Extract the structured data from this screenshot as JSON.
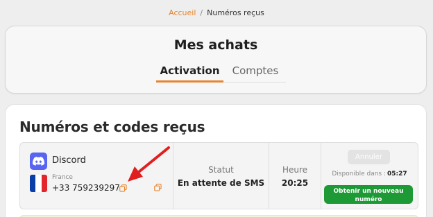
{
  "breadcrumb": {
    "home": "Accueil",
    "separator": "/",
    "current": "Numéros reçus"
  },
  "header": {
    "title": "Mes achats",
    "tabs": [
      {
        "label": "Activation",
        "active": true
      },
      {
        "label": "Comptes",
        "active": false
      }
    ]
  },
  "main": {
    "section_title": "Numéros et codes reçus",
    "rows": [
      {
        "service": "Discord",
        "service_icon": "discord-icon",
        "country": "France",
        "flag_icon": "france-flag-icon",
        "phone": "+33 759239297",
        "status_label": "Statut",
        "status_value": "En attente de SMS",
        "time_label": "Heure",
        "time_value": "20:25",
        "cancel_label": "Annuler",
        "available_label": "Disponible dans :",
        "available_value": "05:27",
        "new_number_label": "Obtenir un nouveau numéro"
      }
    ]
  },
  "colors": {
    "accent": "#e8842c",
    "discord": "#5865f2",
    "success": "#1d9a35",
    "annotation_arrow": "#e02020"
  }
}
